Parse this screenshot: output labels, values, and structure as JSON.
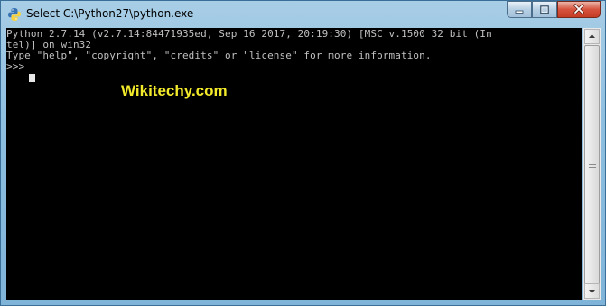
{
  "window": {
    "title": "Select C:\\Python27\\python.exe",
    "icon": "python-icon"
  },
  "controls": {
    "minimize": "minimize-icon",
    "maximize": "maximize-icon",
    "close": "close-icon"
  },
  "console": {
    "lines": [
      "Python 2.7.14 (v2.7.14:84471935ed, Sep 16 2017, 20:19:30) [MSC v.1500 32 bit (In",
      "tel)] on win32",
      "Type \"help\", \"copyright\", \"credits\" or \"license\" for more information.",
      ">>> "
    ],
    "text_color": "#c0c0c0",
    "background": "#000000"
  },
  "watermark": {
    "text": "Wikitechy.com",
    "color": "#f2ea2a"
  },
  "colors": {
    "close_button": "#c43c24",
    "frame": "#8ebfe0"
  }
}
